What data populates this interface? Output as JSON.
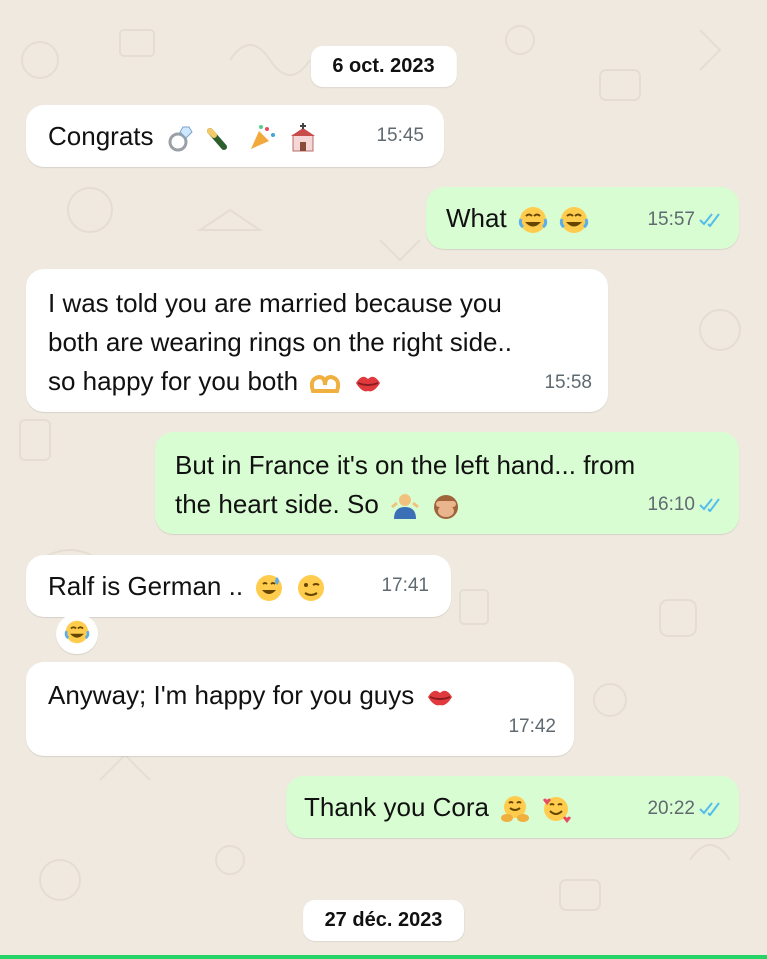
{
  "date_separators": {
    "first": "6 oct. 2023",
    "second": "27 déc. 2023"
  },
  "messages": [
    {
      "direction": "incoming",
      "text": "Congrats",
      "emojis": [
        "ring",
        "champagne",
        "party-popper",
        "wedding-chapel"
      ],
      "time": "15:45"
    },
    {
      "direction": "outgoing",
      "text": "What",
      "emojis": [
        "joy",
        "joy"
      ],
      "time": "15:57",
      "read": true
    },
    {
      "direction": "incoming",
      "lines": [
        "I was told you are married because you",
        "both are wearing rings on the right side..",
        "so happy for you both"
      ],
      "emojis": [
        "heart-hands",
        "kiss-mark"
      ],
      "time": "15:58"
    },
    {
      "direction": "outgoing",
      "lines": [
        "But in France it's on the left hand... from",
        "the heart side. So"
      ],
      "emojis": [
        "man-shrugging",
        "see-no-evil-monkey"
      ],
      "time": "16:10",
      "read": true
    },
    {
      "direction": "incoming",
      "text": "Ralf is German ..",
      "emojis": [
        "grinning-sweat",
        "winking-face"
      ],
      "time": "17:41"
    },
    {
      "direction": "incoming",
      "text": "",
      "emojis": [
        "joy"
      ],
      "time": ""
    },
    {
      "direction": "incoming",
      "text": "Anyway; I'm happy for you guys",
      "emojis": [
        "kiss-mark"
      ],
      "time": "17:42"
    },
    {
      "direction": "outgoing",
      "text": "Thank you Cora",
      "emojis": [
        "hugging-face",
        "smiling-face-with-hearts"
      ],
      "time": "20:22",
      "read": true
    }
  ],
  "colors": {
    "background": "#efe9df",
    "incoming_bubble": "#ffffff",
    "outgoing_bubble": "#d9fdd3",
    "read_tick": "#53bdeb",
    "timestamp": "#5f6a70",
    "accent": "#25d366"
  }
}
